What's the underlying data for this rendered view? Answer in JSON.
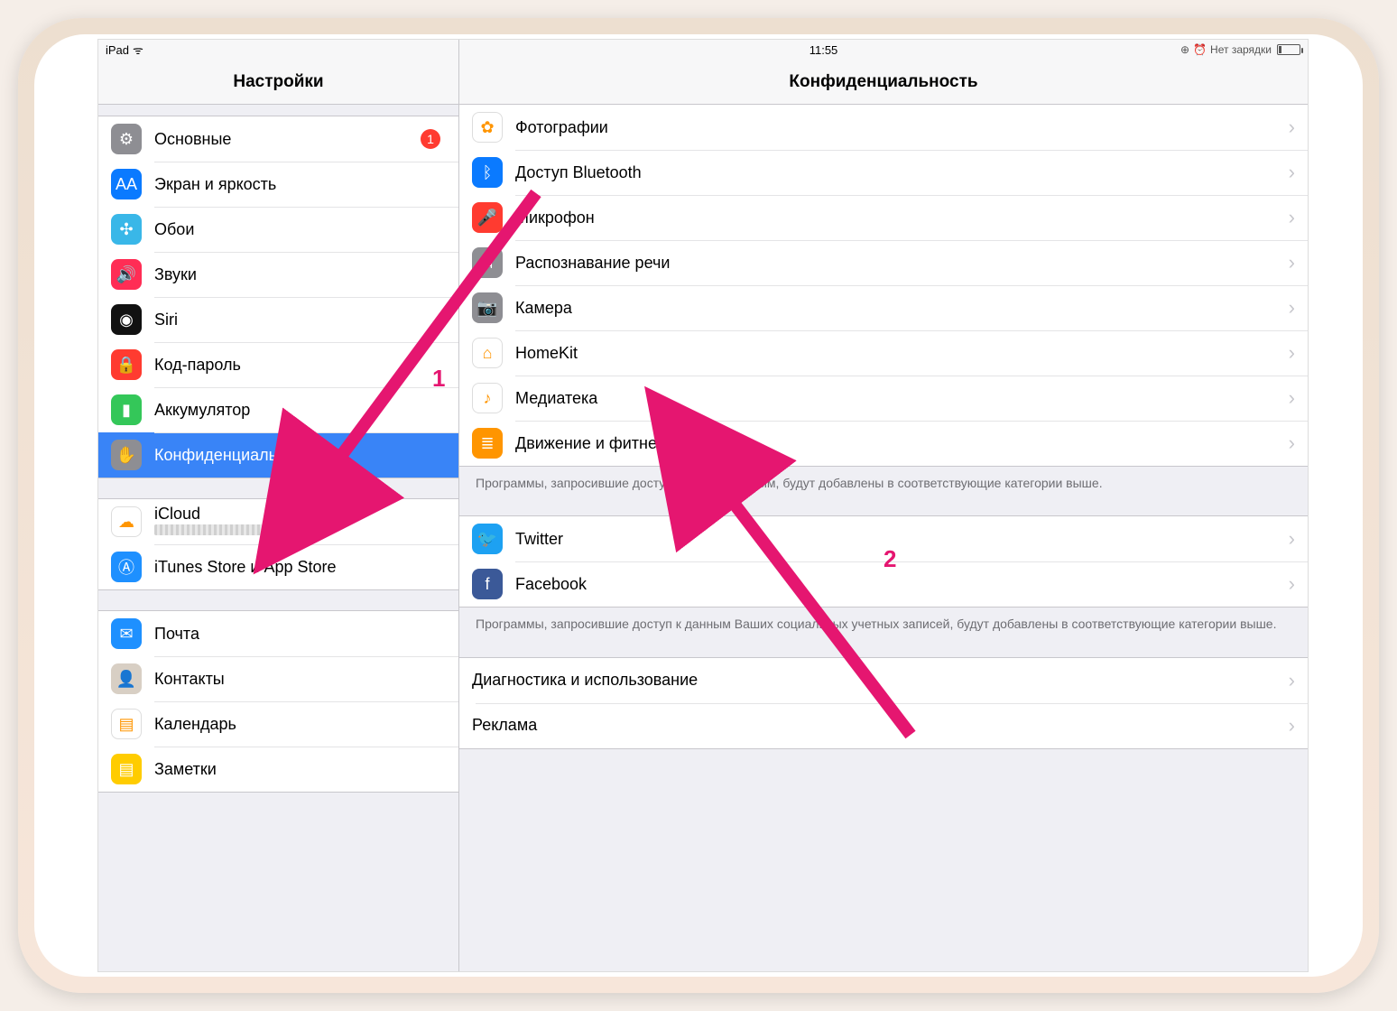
{
  "status": {
    "device": "iPad",
    "time": "11:55",
    "charge": "Нет зарядки"
  },
  "sidebar": {
    "title": "Настройки",
    "g1": [
      {
        "label": "Основные",
        "badge": "1",
        "color": "#8e8e93",
        "glyph": "⚙"
      },
      {
        "label": "Экран и яркость",
        "color": "#0a7aff",
        "glyph": "AA"
      },
      {
        "label": "Обои",
        "color": "#39b7e8",
        "glyph": "✣"
      },
      {
        "label": "Звуки",
        "color": "#ff2d55",
        "glyph": "🔊"
      },
      {
        "label": "Siri",
        "color": "#111",
        "glyph": "◉"
      },
      {
        "label": "Код-пароль",
        "color": "#ff3b30",
        "glyph": "🔒"
      },
      {
        "label": "Аккумулятор",
        "color": "#34c759",
        "glyph": "▮"
      },
      {
        "label": "Конфиденциальность",
        "color": "#8e8e93",
        "glyph": "✋",
        "selected": true
      }
    ],
    "g2": [
      {
        "label": "iCloud",
        "color": "#fff",
        "glyph": "☁"
      },
      {
        "label": "iTunes Store и App Store",
        "color": "#1e90ff",
        "glyph": "Ⓐ"
      }
    ],
    "g3": [
      {
        "label": "Почта",
        "color": "#1e90ff",
        "glyph": "✉"
      },
      {
        "label": "Контакты",
        "color": "#d8cfc4",
        "glyph": "👤"
      },
      {
        "label": "Календарь",
        "color": "#fff",
        "glyph": "▤"
      },
      {
        "label": "Заметки",
        "color": "#ffcc00",
        "glyph": "▤"
      }
    ]
  },
  "detail": {
    "title": "Конфиденциальность",
    "g1": [
      {
        "label": "Фотографии",
        "color": "#fff",
        "glyph": "✿"
      },
      {
        "label": "Доступ Bluetooth",
        "color": "#0a7aff",
        "glyph": "ᛒ"
      },
      {
        "label": "Микрофон",
        "color": "#ff3b30",
        "glyph": "🎤"
      },
      {
        "label": "Распознавание речи",
        "color": "#8e8e93",
        "glyph": "⧦"
      },
      {
        "label": "Камера",
        "color": "#8e8e93",
        "glyph": "📷"
      },
      {
        "label": "HomeKit",
        "color": "#fff",
        "glyph": "⌂"
      },
      {
        "label": "Медиатека",
        "color": "#fff",
        "glyph": "♪"
      },
      {
        "label": "Движение и фитнес",
        "color": "#ff9500",
        "glyph": "≣"
      }
    ],
    "note1": "Программы, запросившие доступ к Вашим данным, будут добавлены в соответствующие категории выше.",
    "g2": [
      {
        "label": "Twitter",
        "color": "#1da1f2",
        "glyph": "🐦"
      },
      {
        "label": "Facebook",
        "color": "#3b5998",
        "glyph": "f"
      }
    ],
    "note2": "Программы, запросившие доступ к данным Ваших социальных учетных записей, будут добавлены в соответствующие категории выше.",
    "g3": [
      {
        "label": "Диагностика и использование"
      },
      {
        "label": "Реклама"
      }
    ]
  },
  "annotations": {
    "num1": "1",
    "num2": "2"
  }
}
